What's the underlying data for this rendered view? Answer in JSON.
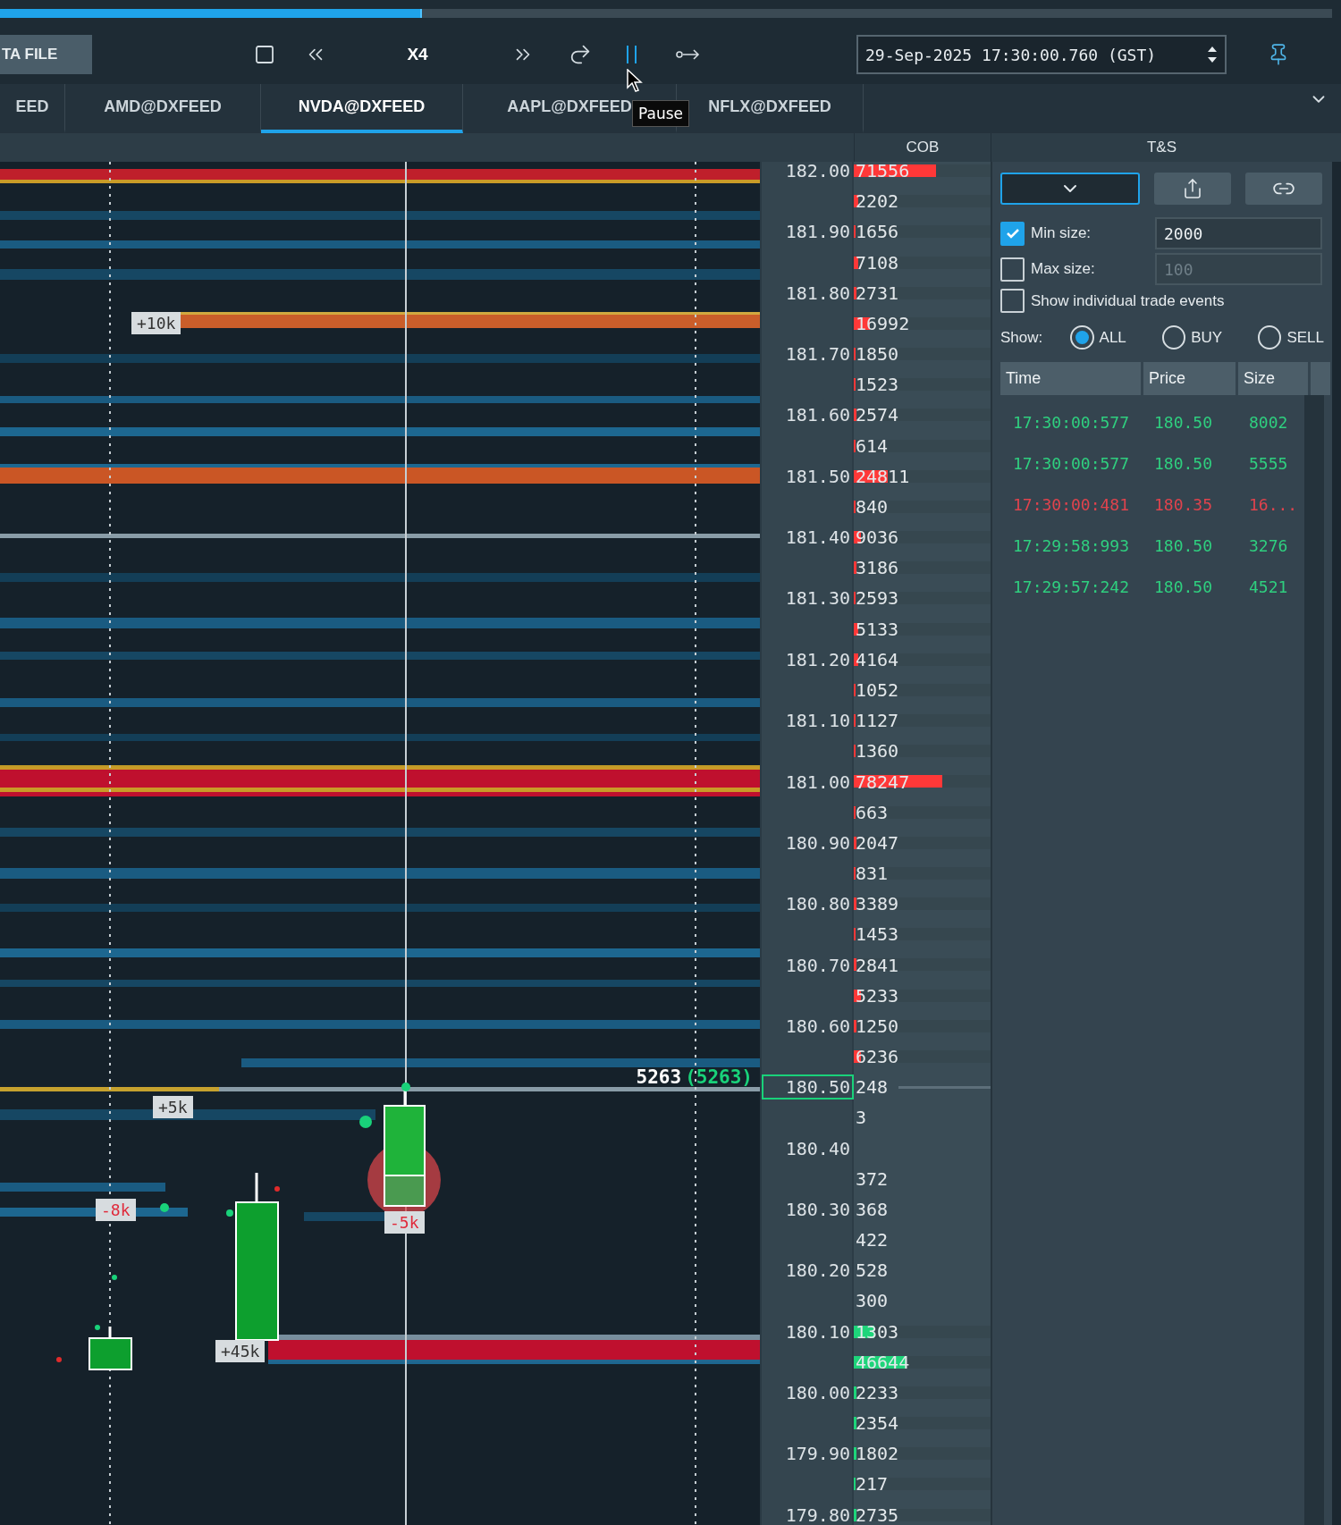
{
  "progress": {
    "level": 0.317
  },
  "toolbar": {
    "file_button": "TA FILE",
    "speed": "X4",
    "tooltip": "Pause",
    "datetime": "29-Sep-2025 17:30:00.760 (GST)"
  },
  "tabs": [
    {
      "label": "EED",
      "selected": false
    },
    {
      "label": "AMD@DXFEED",
      "selected": false
    },
    {
      "label": "NVDA@DXFEED",
      "selected": true
    },
    {
      "label": "AAPL@DXFEED",
      "selected": false
    },
    {
      "label": "NFLX@DXFEED",
      "selected": false
    }
  ],
  "headers": {
    "cob": "COB",
    "ts": "T&S"
  },
  "chart": {
    "labels": [
      {
        "text": "+10k",
        "color": "#333333"
      },
      {
        "text": "+5k",
        "color": "#333333"
      },
      {
        "text": "-8k",
        "color": "#e0293a"
      },
      {
        "text": "-5k",
        "color": "#e0293a"
      },
      {
        "text": "+45k",
        "color": "#333333"
      }
    ],
    "last_trade": {
      "size": "5263",
      "total": "(5263)"
    }
  },
  "ladder": {
    "rows": [
      {
        "price": "182.00",
        "size": "71556",
        "color": "#ff3838",
        "level": 0.6,
        "current": false
      },
      {
        "size": "2202",
        "color": "#ff3838",
        "level": 0.03
      },
      {
        "price": "181.90",
        "size": "1656",
        "color": "#ff3838",
        "level": 0.01,
        "current": false
      },
      {
        "size": "7108",
        "color": "#ff3838",
        "level": 0.03
      },
      {
        "price": "181.80",
        "size": "2731",
        "color": "#ff3838",
        "level": 0.02,
        "current": false
      },
      {
        "size": "16992",
        "color": "#ff3838",
        "level": 0.12
      },
      {
        "price": "181.70",
        "size": "1850",
        "color": "#ff3838",
        "level": 0.01,
        "current": false
      },
      {
        "size": "1523",
        "color": "#ff3838",
        "level": 0.01
      },
      {
        "price": "181.60",
        "size": "2574",
        "color": "#ff3838",
        "level": 0.02,
        "current": false
      },
      {
        "size": "614",
        "color": "#ff3838",
        "level": 0.01
      },
      {
        "price": "181.50",
        "size": "24811",
        "color": "#ff3838",
        "level": 0.25,
        "current": false
      },
      {
        "size": "840",
        "color": "#ff3838",
        "level": 0.01
      },
      {
        "price": "181.40",
        "size": "9036",
        "color": "#ff3838",
        "level": 0.05,
        "current": false
      },
      {
        "size": "3186",
        "color": "#ff3838",
        "level": 0.02
      },
      {
        "price": "181.30",
        "size": "2593",
        "color": "#ff3838",
        "level": 0.01,
        "current": false
      },
      {
        "size": "5133",
        "color": "#ff3838",
        "level": 0.03
      },
      {
        "price": "181.20",
        "size": "4164",
        "color": "#ff3838",
        "level": 0.03,
        "current": false
      },
      {
        "size": "1052",
        "color": "#ff3838",
        "level": 0.01
      },
      {
        "price": "181.10",
        "size": "1127",
        "color": "#ff3838",
        "level": 0.01,
        "current": false
      },
      {
        "size": "1360",
        "color": "#ff3838",
        "level": 0.01
      },
      {
        "price": "181.00",
        "size": "78247",
        "color": "#ff3838",
        "level": 0.65,
        "current": false
      },
      {
        "size": "663",
        "color": "#ff3838",
        "level": 0.01
      },
      {
        "price": "180.90",
        "size": "2047",
        "color": "#ff3838",
        "level": 0.02,
        "current": false
      },
      {
        "size": "831",
        "color": "#ff3838",
        "level": 0.01
      },
      {
        "price": "180.80",
        "size": "3389",
        "color": "#ff3838",
        "level": 0.02,
        "current": false
      },
      {
        "size": "1453",
        "color": "#ff3838",
        "level": 0.01
      },
      {
        "price": "180.70",
        "size": "2841",
        "color": "#ff3838",
        "level": 0.02,
        "current": false
      },
      {
        "size": "5233",
        "color": "#ff3838",
        "level": 0.05
      },
      {
        "price": "180.60",
        "size": "1250",
        "color": "#ff3838",
        "level": 0.02,
        "current": false
      },
      {
        "size": "6236",
        "color": "#ff3838",
        "level": 0.05
      },
      {
        "price": "180.50",
        "size": "248",
        "current": true
      },
      {
        "size": "3"
      },
      {
        "price": "180.40",
        "current": false
      },
      {
        "size": "372"
      },
      {
        "price": "180.30",
        "size": "368",
        "current": false
      },
      {
        "size": "422"
      },
      {
        "price": "180.20",
        "size": "528",
        "current": false
      },
      {
        "size": "300"
      },
      {
        "price": "180.10",
        "size": "1303",
        "color": "#1ed47a",
        "level": 0.15,
        "current": false
      },
      {
        "size": "46644",
        "color": "#1ed47a",
        "level": 0.38
      },
      {
        "price": "180.00",
        "size": "2233",
        "color": "#1ed47a",
        "level": 0.02,
        "current": false
      },
      {
        "size": "2354",
        "color": "#1ed47a",
        "level": 0.02
      },
      {
        "price": "179.90",
        "size": "1802",
        "color": "#1ed47a",
        "level": 0.02,
        "current": false
      },
      {
        "size": "217",
        "color": "#1ed47a",
        "level": 0.01
      },
      {
        "price": "179.80",
        "size": "2735",
        "color": "#1ed47a",
        "level": 0.02,
        "current": false
      }
    ]
  },
  "ts": {
    "min_size": {
      "label": "Min size:",
      "checked": true,
      "value": "2000"
    },
    "max_size": {
      "label": "Max size:",
      "checked": false,
      "value": "100",
      "disabled": true
    },
    "individual": {
      "label": "Show individual trade events",
      "checked": false
    },
    "show": {
      "label": "Show:",
      "options": [
        {
          "label": "ALL",
          "selected": true
        },
        {
          "label": "BUY",
          "selected": false
        },
        {
          "label": "SELL",
          "selected": false
        }
      ]
    },
    "columns": [
      "Time",
      "Price",
      "Size"
    ],
    "trades": [
      {
        "time": "17:30:00:577",
        "price": "180.50",
        "size": "8002",
        "color": "#2fcf7f"
      },
      {
        "time": "17:30:00:577",
        "price": "180.50",
        "size": "5555",
        "color": "#2fcf7f"
      },
      {
        "time": "17:30:00:481",
        "price": "180.35",
        "size": "16...",
        "color": "#e0434d"
      },
      {
        "time": "17:29:58:993",
        "price": "180.50",
        "size": "3276",
        "color": "#2fcf7f"
      },
      {
        "time": "17:29:57:242",
        "price": "180.50",
        "size": "4521",
        "color": "#2fcf7f"
      }
    ]
  }
}
